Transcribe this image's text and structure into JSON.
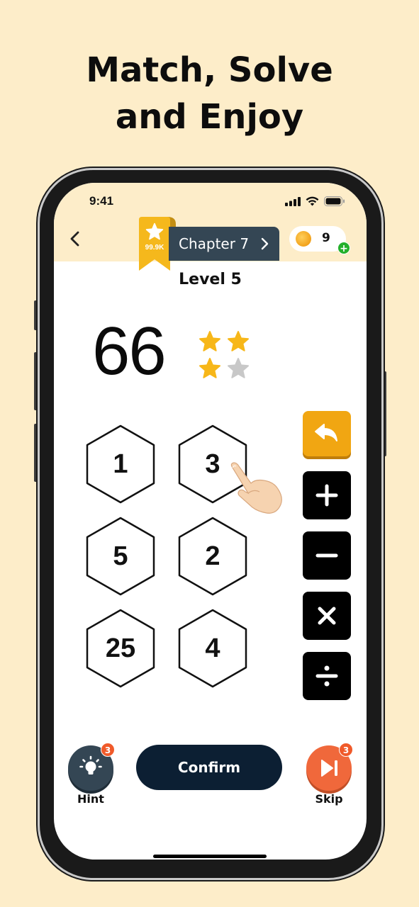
{
  "headline": {
    "line1": "Match, Solve",
    "line2": "and Enjoy"
  },
  "status_bar": {
    "time": "9:41",
    "icons": [
      "signal-icon",
      "wifi-icon",
      "battery-icon"
    ]
  },
  "header": {
    "back_icon": "chevron-left-icon",
    "ribbon": {
      "icon": "star-icon",
      "count": "99.9K",
      "color": "#f5b81c"
    },
    "chapter": {
      "label": "Chapter 7",
      "icon": "chevron-right-icon",
      "color": "#344654"
    },
    "coins": {
      "count": "9",
      "icon": "coin-icon",
      "add_icon": "plus-icon"
    }
  },
  "level": {
    "label": "Level 5"
  },
  "target": {
    "value": "66"
  },
  "rating": {
    "earned": 3,
    "total": 4,
    "filled_color": "#f7b719",
    "empty_color": "#c8c8c8"
  },
  "tiles": [
    {
      "value": "1"
    },
    {
      "value": "3"
    },
    {
      "value": "5"
    },
    {
      "value": "2"
    },
    {
      "value": "25"
    },
    {
      "value": "4"
    }
  ],
  "operators": [
    {
      "name": "undo",
      "icon": "undo-icon",
      "color": "#f1a612"
    },
    {
      "name": "add",
      "icon": "plus-icon",
      "color": "#000000"
    },
    {
      "name": "subtract",
      "icon": "minus-icon",
      "color": "#000000"
    },
    {
      "name": "multiply",
      "icon": "multiply-icon",
      "color": "#000000"
    },
    {
      "name": "divide",
      "icon": "divide-icon",
      "color": "#000000"
    }
  ],
  "footer": {
    "hint": {
      "label": "Hint",
      "badge": "3",
      "icon": "lightbulb-icon"
    },
    "confirm": {
      "label": "Confirm"
    },
    "skip": {
      "label": "Skip",
      "badge": "3",
      "icon": "skip-icon"
    }
  }
}
